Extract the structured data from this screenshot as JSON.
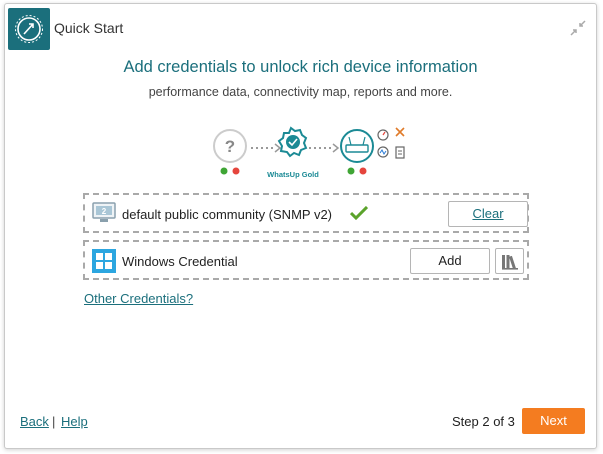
{
  "dialog": {
    "title": "Quick Start",
    "headline": "Add credentials to unlock rich device information",
    "subline": "performance data, connectivity map, reports and more."
  },
  "diagram": {
    "brand_label": "WhatsUp Gold",
    "unknown_mark": "?"
  },
  "credentials": [
    {
      "label": "default public community (SNMP v2)",
      "icon": "monitor-icon",
      "status": "check-icon",
      "button_label": "Clear"
    },
    {
      "label": "Windows Credential",
      "icon": "windows-icon",
      "button_label": "Add",
      "library_icon": "library-icon"
    }
  ],
  "links": {
    "other": "Other Credentials?",
    "back": "Back",
    "separator": "|",
    "help": "Help"
  },
  "footer": {
    "step": "Step 2 of 3",
    "next_label": "Next"
  },
  "colors": {
    "accent": "#1b6f7c",
    "next_button": "#f47c20",
    "check": "#5ba32b",
    "status_green": "#3fa535",
    "status_red": "#e5453d"
  }
}
